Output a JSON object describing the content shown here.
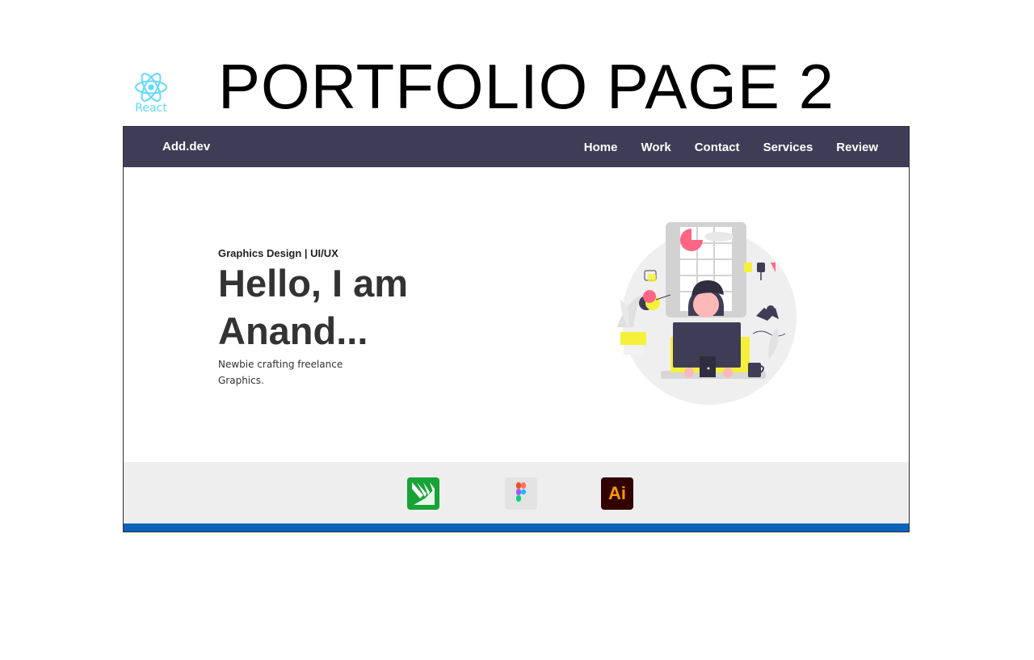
{
  "badge": {
    "react_label": "React"
  },
  "page_title": "PORTFOLIO PAGE 2",
  "navbar": {
    "brand": "Add.dev",
    "links": [
      "Home",
      "Work",
      "Contact",
      "Services",
      "Review"
    ]
  },
  "hero": {
    "subtitle": "Graphics Design | UI/UX",
    "heading": "Hello, I am Anand...",
    "description": "Newbie crafting freelance Graphics."
  },
  "tools": {
    "items": [
      {
        "name": "coreldraw-icon"
      },
      {
        "name": "figma-icon"
      },
      {
        "name": "illustrator-icon",
        "label": "Ai"
      }
    ]
  },
  "colors": {
    "navbar": "#3f3d56",
    "react": "#61dafb",
    "accent_yellow": "#f5f13b",
    "accent_pink": "#ff6584",
    "footer_bar": "#0b63b8"
  }
}
